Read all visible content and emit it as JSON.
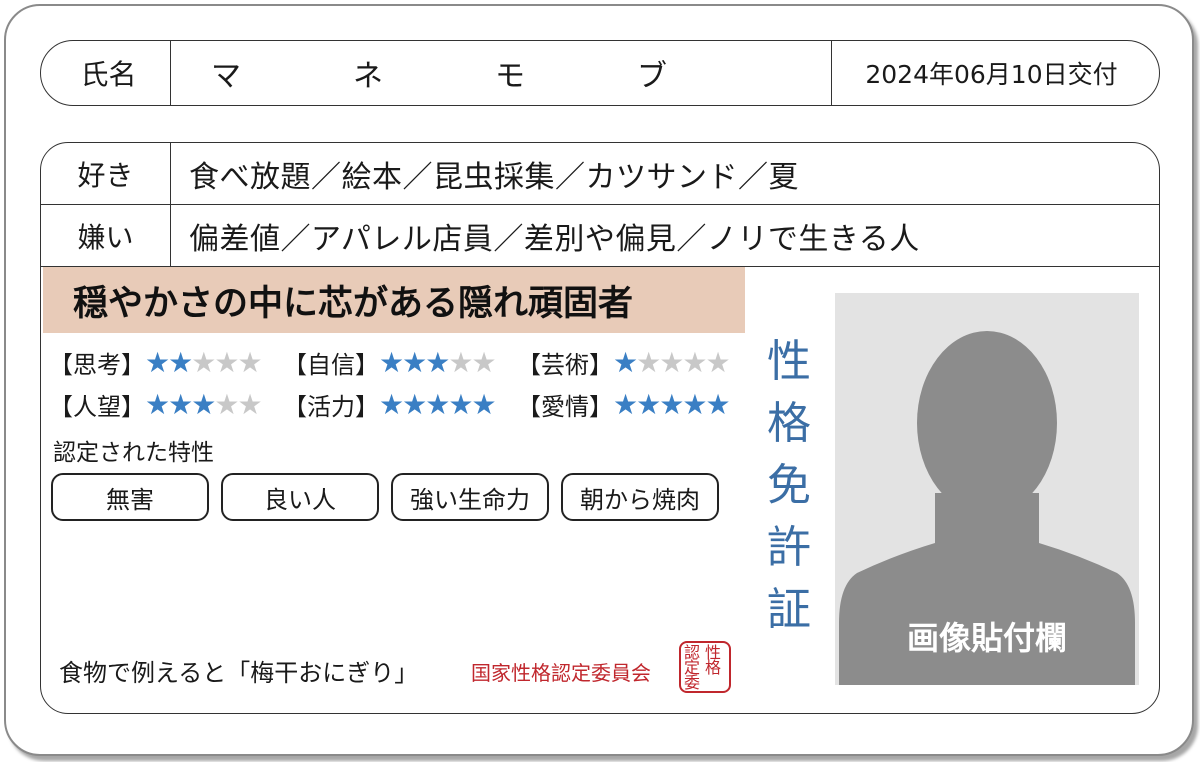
{
  "name": {
    "label": "氏名",
    "chars": [
      "マ",
      "ネ",
      "モ",
      "ブ"
    ],
    "issue_date": "2024年06月10日交付"
  },
  "likes": {
    "label": "好き",
    "value": "食べ放題／絵本／昆虫採集／カツサンド／夏"
  },
  "dislikes": {
    "label": "嫌い",
    "value": "偏差値／アパレル店員／差別や偏見／ノリで生きる人"
  },
  "headline": "穏やかさの中に芯がある隠れ頑固者",
  "ratings": [
    {
      "label": "【思考】",
      "stars": 2
    },
    {
      "label": "【自信】",
      "stars": 3
    },
    {
      "label": "【芸術】",
      "stars": 1
    },
    {
      "label": "【人望】",
      "stars": 3
    },
    {
      "label": "【活力】",
      "stars": 5
    },
    {
      "label": "【愛情】",
      "stars": 5
    }
  ],
  "stars_max": 5,
  "traits": {
    "title": "認定された特性",
    "items": [
      "無害",
      "良い人",
      "強い生命力",
      "朝から焼肉"
    ]
  },
  "food": "食物で例えると「梅干おにぎり」",
  "org": "国家性格認定委員会",
  "seal": [
    "性格",
    "認定委"
  ],
  "license_title": [
    "性",
    "格",
    "免",
    "許",
    "証"
  ],
  "photo_label": "画像貼付欄",
  "colors": {
    "star_on": "#3a7fc4",
    "star_off": "#c8c8c8",
    "headline_bg": "#e8cbb8",
    "license_title": "#3b6ea5",
    "seal": "#c0272d",
    "silhouette": "#8c8c8c",
    "photo_bg": "#e3e3e3"
  }
}
